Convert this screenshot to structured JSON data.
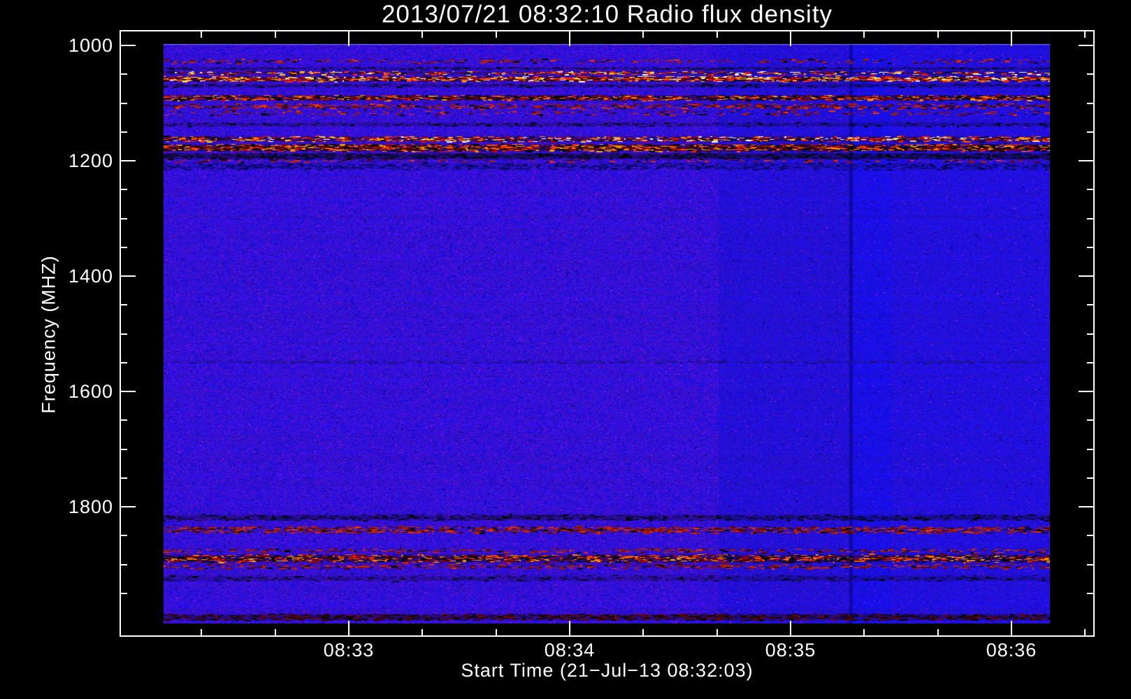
{
  "figure": {
    "background_color": "#000000",
    "text_color": "#ffffff"
  },
  "chart_data": {
    "type": "heatmap",
    "title": "2013/07/21 08:32:10 Radio flux density",
    "xlabel": "Start Time (21−Jul−13 08:32:03)",
    "ylabel": "Frequency (MHZ)",
    "legend": "none",
    "grid": "off",
    "x_axis": {
      "major_ticks": [
        "08:33",
        "08:34",
        "08:35",
        "08:36"
      ],
      "minor_tick_interval_s": 20,
      "start_time_shown": "08:32:03"
    },
    "y_axis": {
      "major_ticks": [
        "1000",
        "1200",
        "1400",
        "1600",
        "1800"
      ],
      "minor_tick_interval_mhz": 50,
      "unit": "MHZ",
      "direction": "increasing-downward",
      "range_mhz": [
        975,
        2025
      ]
    },
    "image": {
      "time_start": "08:32:10",
      "duration_s": 240,
      "freq_top_mhz": 998,
      "freq_bottom_mhz": 2002,
      "background_color": "#2312dc",
      "palettes": {
        "hot": [
          "#000000",
          "#1a0000",
          "#660000",
          "#aa0000",
          "#dd1100",
          "#ff5500",
          "#ff9900",
          "#ffdd33",
          "#ffffff",
          "#ff2200"
        ],
        "hot2": [
          "#000000",
          "#000000",
          "#330000",
          "#770000",
          "#bb0000",
          "#ee2200",
          "#ff6600",
          "#ffaa00",
          "#110022"
        ],
        "red": [
          "#550000",
          "#881100",
          "#bb2200",
          "#ee3300",
          "#000000",
          "#992200"
        ],
        "dark": [
          "#000000",
          "#05051a",
          "#0a0a44",
          "#11115f",
          "#1a0f66"
        ],
        "darkblue": [
          "#0a0870",
          "#100c88",
          "#060455",
          "#1a14a0"
        ],
        "darkred": [
          "#1a0000",
          "#440000",
          "#6f0a00",
          "#000000",
          "#2a0a22"
        ],
        "faintdark": [
          "#1c10a8",
          "#180c90",
          "#22138f"
        ]
      },
      "rfi_bands": [
        {
          "f1": 1022,
          "f2": 1031,
          "style": "red",
          "density": 0.22
        },
        {
          "f1": 1036,
          "f2": 1042,
          "style": "dark",
          "density": 0.3
        },
        {
          "f1": 1044,
          "f2": 1051,
          "style": "hot",
          "density": 0.45
        },
        {
          "f1": 1052,
          "f2": 1063,
          "style": "hot",
          "density": 0.8
        },
        {
          "f1": 1066,
          "f2": 1073,
          "style": "dark",
          "density": 0.3
        },
        {
          "f1": 1085,
          "f2": 1096,
          "style": "hot2",
          "density": 0.75
        },
        {
          "f1": 1099,
          "f2": 1110,
          "style": "red",
          "density": 0.4
        },
        {
          "f1": 1112,
          "f2": 1121,
          "style": "red",
          "density": 0.2
        },
        {
          "f1": 1132,
          "f2": 1141,
          "style": "dark",
          "density": 0.25
        },
        {
          "f1": 1156,
          "f2": 1167,
          "style": "hot",
          "density": 0.55
        },
        {
          "f1": 1170,
          "f2": 1184,
          "style": "hot2",
          "density": 0.85
        },
        {
          "f1": 1186,
          "f2": 1197,
          "style": "dark",
          "density": 0.65
        },
        {
          "f1": 1197,
          "f2": 1203,
          "style": "red",
          "density": 0.25
        },
        {
          "f1": 1203,
          "f2": 1216,
          "style": "darkblue",
          "density": 0.55
        },
        {
          "f1": 1545,
          "f2": 1552,
          "style": "faintdark",
          "density": 0.5
        },
        {
          "f1": 1812,
          "f2": 1824,
          "style": "dark",
          "density": 0.4
        },
        {
          "f1": 1833,
          "f2": 1846,
          "style": "red",
          "density": 0.55
        },
        {
          "f1": 1872,
          "f2": 1880,
          "style": "red",
          "density": 0.3
        },
        {
          "f1": 1881,
          "f2": 1897,
          "style": "hot2",
          "density": 0.65
        },
        {
          "f1": 1898,
          "f2": 1908,
          "style": "red",
          "density": 0.35
        },
        {
          "f1": 1918,
          "f2": 1930,
          "style": "dark",
          "density": 0.2
        },
        {
          "f1": 1984,
          "f2": 1998,
          "style": "darkred",
          "density": 0.55
        }
      ],
      "vertical_features": [
        {
          "t1": 150,
          "t2": 186,
          "effect": "less-noise"
        },
        {
          "t1": 185.6,
          "t2": 186.4,
          "effect": "dark-line"
        },
        {
          "t1": 186.4,
          "t2": 197,
          "effect": "bright-column"
        },
        {
          "t1": 197,
          "t2": 240,
          "effect": "purer-blue"
        }
      ]
    }
  }
}
